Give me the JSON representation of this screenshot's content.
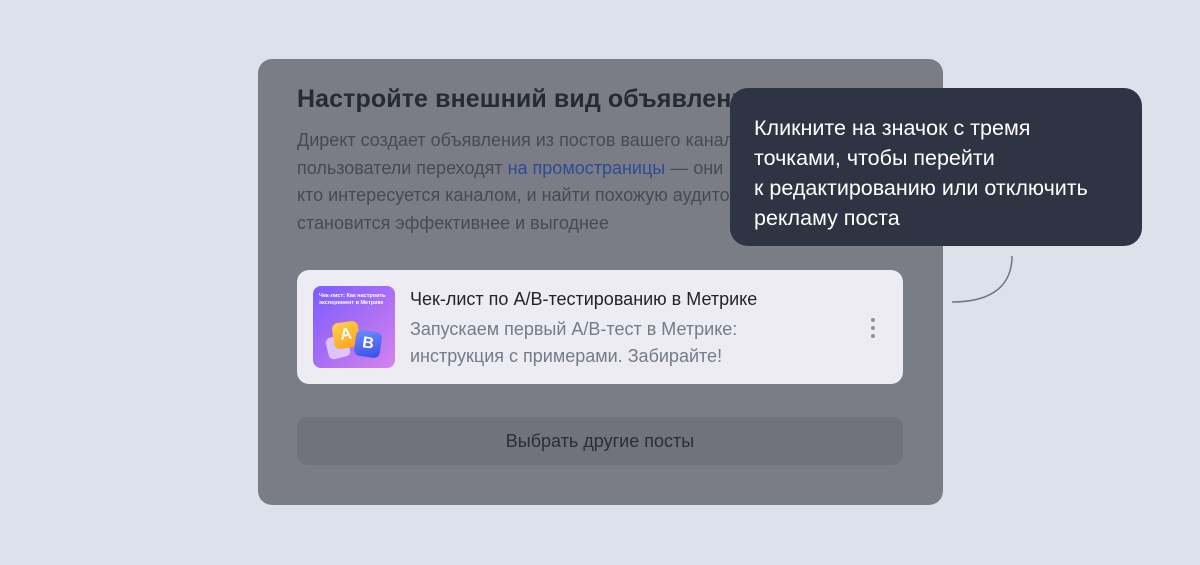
{
  "card": {
    "title": "Настройте внешний вид объявлений",
    "description_lines": [
      {
        "before": "Директ создает объявления из постов вашего канала —",
        "link": "",
        "after": ""
      },
      {
        "before": "пользователи переходят ",
        "link": "на промостраницы",
        "after": " — они"
      },
      {
        "before": "кто интересуется каналом, и найти похожую аудиторию",
        "link": "",
        "after": ""
      },
      {
        "before": "становится эффективнее и выгоднее",
        "link": "",
        "after": ""
      }
    ]
  },
  "post": {
    "thumbnail_caption": "Чек-лист: Как настроить эксперимент в Метрике",
    "thumbnail_tile_a": "A",
    "thumbnail_tile_b": "B",
    "title": "Чек-лист по A/B-тестированию в Метрике",
    "text_lines": [
      "Запускаем первый A/B-тест в Метрике:",
      "инструкция с примерами. Забирайте!"
    ],
    "more_icon": "three-dots-vertical"
  },
  "select_button_label": "Выбрать другие посты",
  "tooltip": {
    "lines": [
      "Кликните на значок с тремя",
      "точками, чтобы перейти",
      "к редактированию или отключить",
      "рекламу поста"
    ]
  },
  "colors": {
    "page_background": "#dce1ec",
    "overlay": "#7a7d85",
    "tooltip_background": "#2f3444",
    "link": "#2b4a99"
  }
}
